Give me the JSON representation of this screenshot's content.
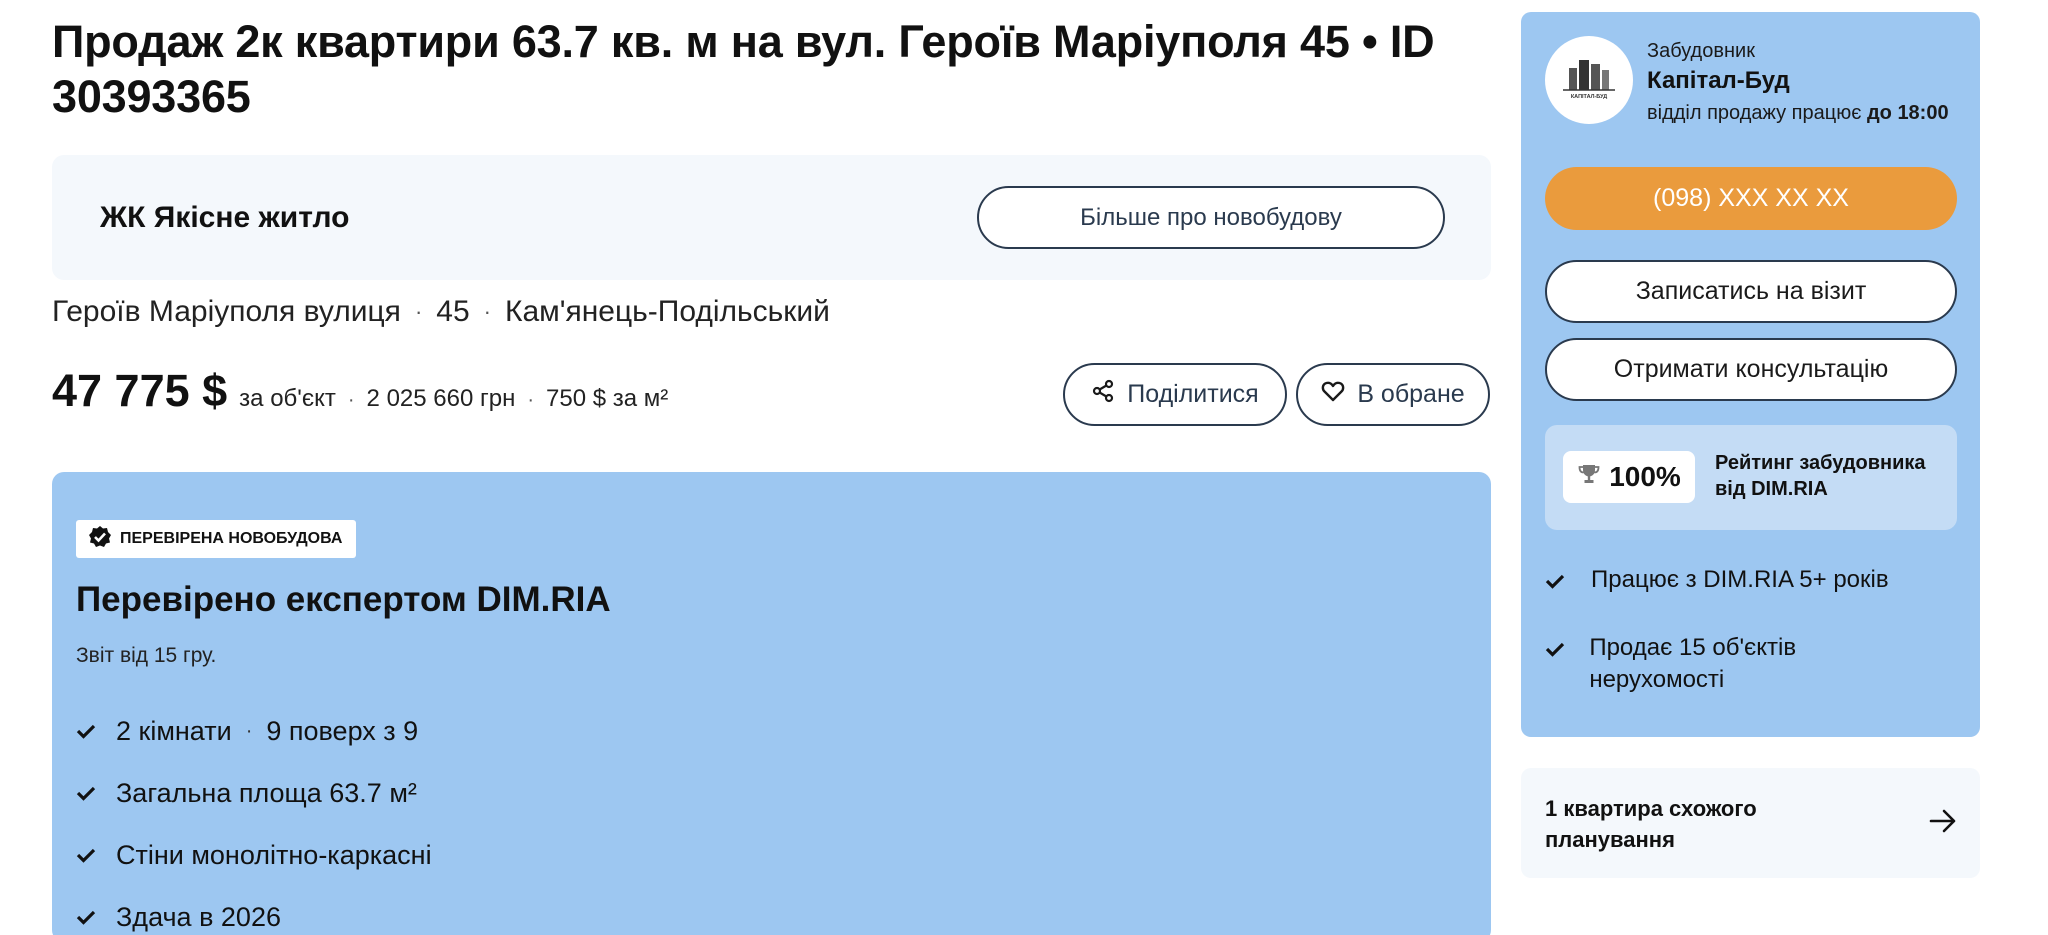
{
  "listing": {
    "title": "Продаж 2к квартири 63.7 кв. м на вул. Героїв Маріуполя 45 • ID 30393365",
    "complex_name": "ЖК Якісне житло",
    "more_about_button": "Більше про новобудову",
    "address": {
      "street": "Героїв Маріуполя вулиця",
      "number": "45",
      "city": "Кам'янець-Подільський"
    },
    "price": {
      "main": "47 775 $",
      "per_object": "за об'єкт",
      "uah": "2 025 660 грн",
      "per_sqm": "750 $ за м²"
    },
    "actions": {
      "share": "Поділитися",
      "favorite": "В обране"
    }
  },
  "verification": {
    "badge": "ПЕРЕВІРЕНА НОВОБУДОВА",
    "title": "Перевірено експертом DIM.RIA",
    "report_date": "Звіт від 15 гру.",
    "items": [
      {
        "text": "2 кімнати",
        "extra": "9 поверх з 9"
      },
      {
        "text": "Загальна площа 63.7 м²"
      },
      {
        "text": "Стіни монолітно-каркасні"
      },
      {
        "text": "Здача в 2026"
      }
    ]
  },
  "developer": {
    "label": "Забудовник",
    "name": "Капітал-Буд",
    "sales_hours_prefix": "відділ продажу працює",
    "sales_hours_time": "до 18:00",
    "logo_text": "КАПІТАЛ-БУД",
    "phone_button": "(098) XXX XX XX",
    "visit_button": "Записатись на візит",
    "consult_button": "Отримати консультацію",
    "rating_value": "100%",
    "rating_label": "Рейтинг забудовника від DIM.RIA",
    "facts": [
      "Працює з DIM.RIA 5+ років",
      "Продає 15 об'єктів нерухомості"
    ]
  },
  "similar": {
    "label": "1 квартира схожого планування"
  },
  "colors": {
    "panel_blue": "#9dc7f1",
    "light_bg": "#f4f8fc",
    "phone_orange": "#ea9b3d",
    "button_border": "#2a3a4e"
  }
}
